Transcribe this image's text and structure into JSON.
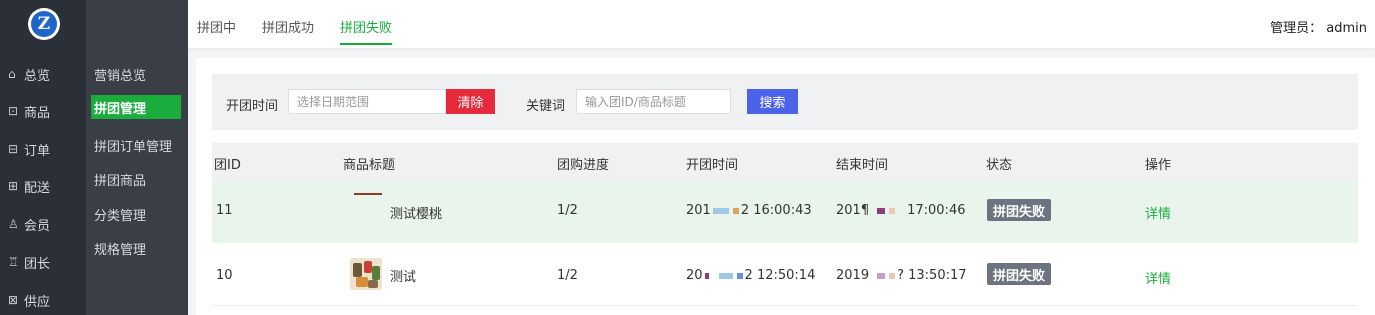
{
  "nav": {
    "primary": [
      {
        "label": "总览",
        "icon": "home-icon",
        "glyph": "⌂"
      },
      {
        "label": "商品",
        "icon": "goods-icon",
        "glyph": "⊡"
      },
      {
        "label": "订单",
        "icon": "order-icon",
        "glyph": "⊟"
      },
      {
        "label": "配送",
        "icon": "delivery-icon",
        "glyph": "⊞"
      },
      {
        "label": "会员",
        "icon": "member-icon",
        "glyph": "♙"
      },
      {
        "label": "团长",
        "icon": "leader-icon",
        "glyph": "♖"
      },
      {
        "label": "供应",
        "icon": "supply-icon",
        "glyph": "⊠"
      }
    ],
    "secondary": [
      {
        "label": "营销总览"
      },
      {
        "label": "拼团管理",
        "active": true
      },
      {
        "label": "拼团订单管理"
      },
      {
        "label": "拼团商品"
      },
      {
        "label": "分类管理"
      },
      {
        "label": "规格管理"
      }
    ]
  },
  "tabs": [
    "拼团中",
    "拼团成功",
    "拼团失败"
  ],
  "active_tab": "拼团失败",
  "admin": "管理员： admin",
  "filter": {
    "time_label": "开团时间",
    "time_placeholder": "选择日期范围",
    "clear_label": "清除",
    "keyword_label": "关键词",
    "keyword_placeholder": "输入团ID/商品标题",
    "search_label": "搜索"
  },
  "table": {
    "headers": [
      "团ID",
      "商品标题",
      "团购进度",
      "开团时间",
      "结束时间",
      "状态",
      "操作"
    ],
    "rows": [
      {
        "id": "11",
        "title": "测试樱桃",
        "progress": "1/2",
        "start_a": "201",
        "start_b": "2 16:00:43",
        "end_a": "201¶",
        "end_b": "17:00:46",
        "status": "拼团失败",
        "action": "详情"
      },
      {
        "id": "10",
        "title": "测试",
        "progress": "1/2",
        "start_a": "20",
        "start_b": "2 12:50:14",
        "end_a": "2019",
        "end_b": "? 13:50:17",
        "status": "拼团失败",
        "action": "详情"
      }
    ]
  },
  "colors": {
    "accent": "#1aad3e",
    "danger": "#e52b3b",
    "primary": "#4b63e8",
    "sidebar": "#2b2f38"
  }
}
